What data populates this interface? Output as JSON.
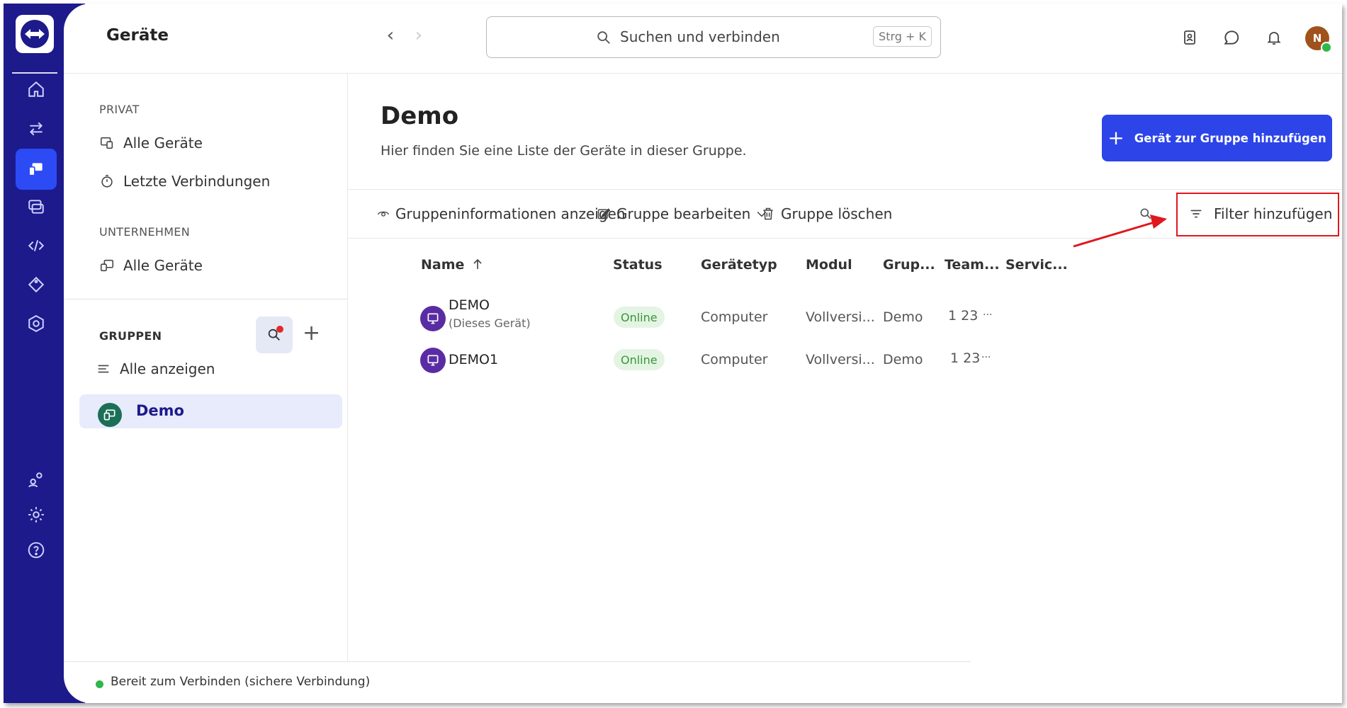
{
  "header": {
    "title": "Geräte",
    "search_placeholder": "Suchen und verbinden",
    "search_shortcut": "Strg + K",
    "avatar_initial": "N"
  },
  "sidebar": {
    "private_label": "PRIVAT",
    "private_items": [
      {
        "label": "Alle Geräte",
        "icon": "devices-icon"
      },
      {
        "label": "Letzte Verbindungen",
        "icon": "stopwatch-icon"
      }
    ],
    "company_label": "UNTERNEHMEN",
    "company_items": [
      {
        "label": "Alle Geräte",
        "icon": "devices-icon"
      }
    ],
    "groups_label": "GRUPPEN",
    "show_all_label": "Alle anzeigen",
    "active_group": "Demo"
  },
  "main": {
    "title": "Demo",
    "subtitle": "Hier finden Sie eine Liste der Geräte in dieser Gruppe.",
    "add_button": "Gerät zur Gruppe hinzufügen",
    "toolbar": {
      "info": "Gruppeninformationen anzeigen",
      "edit": "Gruppe bearbeiten",
      "delete": "Gruppe löschen",
      "filter": "Filter hinzufügen"
    },
    "table": {
      "columns": [
        "Name",
        "Status",
        "Gerätetyp",
        "Modul",
        "Grup...",
        "Team...",
        "Servic..."
      ],
      "rows": [
        {
          "name": "DEMO",
          "sub": "(Dieses Gerät)",
          "status": "Online",
          "type": "Computer",
          "module": "Vollversi...",
          "group": "Demo",
          "team": "1 23",
          "service": "..."
        },
        {
          "name": "DEMO1",
          "sub": "",
          "status": "Online",
          "type": "Computer",
          "module": "Vollversi...",
          "group": "Demo",
          "team": "1 23",
          "service": "..."
        }
      ]
    }
  },
  "status_bar": {
    "text": "Bereit zum Verbinden (sichere Verbindung)"
  },
  "colors": {
    "rail": "#1d1a8c",
    "accent": "#2c44e8",
    "online": "#37963a",
    "highlight_box": "#e0171c"
  }
}
